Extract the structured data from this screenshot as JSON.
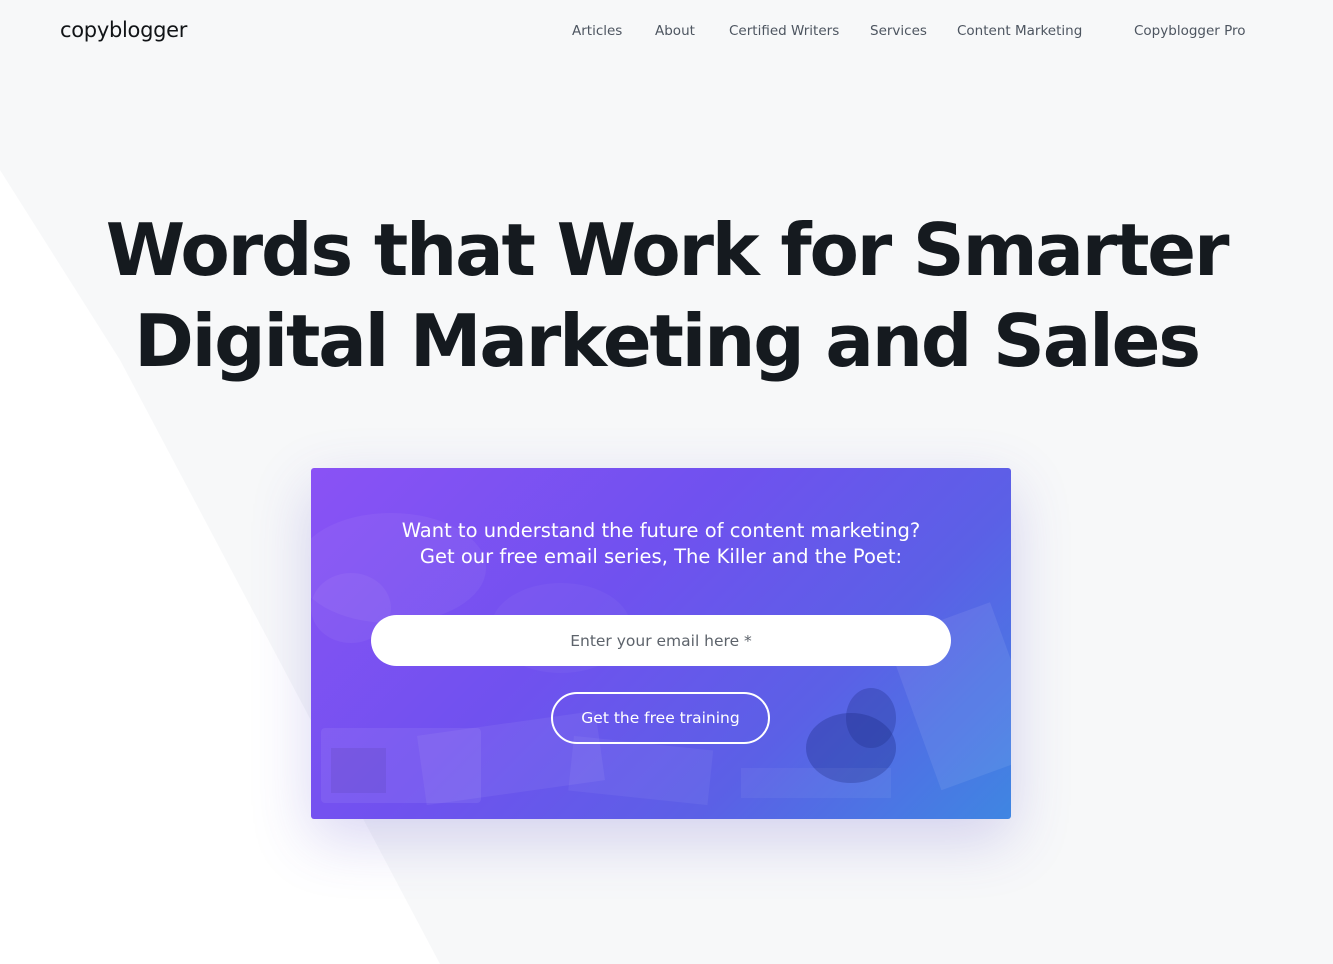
{
  "brand": {
    "logo_text": "copyblogger"
  },
  "nav": {
    "items": [
      {
        "label": "Articles"
      },
      {
        "label": "About"
      },
      {
        "label": "Certified Writers"
      },
      {
        "label": "Services"
      },
      {
        "label": "Content Marketing"
      },
      {
        "label": "Copyblogger Pro"
      }
    ]
  },
  "hero": {
    "title_line1": "Words that Work for Smarter",
    "title_line2": "Digital Marketing and Sales"
  },
  "optin": {
    "line1": "Want to understand the future of content marketing?",
    "line2": "Get our free email series, The Killer and the Poet:",
    "email_placeholder": "Enter your email here *",
    "email_value": "",
    "button_label": "Get the free training"
  },
  "colors": {
    "page_background": "#f7f8f9",
    "heading_text": "#151a1f",
    "nav_text": "#4d5560",
    "card_gradient_start": "#8a52f5",
    "card_gradient_end": "#3f86e2",
    "button_border": "#ffffff"
  }
}
